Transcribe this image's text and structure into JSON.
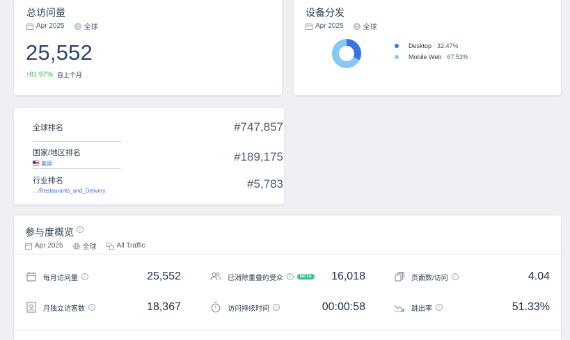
{
  "visits": {
    "title": "总访问量",
    "date": "Apr 2025",
    "region": "全球",
    "value": "25,552",
    "change": "81.97%",
    "change_label": "自上个月"
  },
  "devices": {
    "title": "设备分发",
    "date": "Apr 2025",
    "region": "全球",
    "items": [
      {
        "label": "Desktop",
        "pct": "32.47%",
        "value": 32.47,
        "color": "#3a74e0"
      },
      {
        "label": "Mobile Web",
        "pct": "67.53%",
        "value": 67.53,
        "color": "#86c7f5"
      }
    ]
  },
  "ranks": {
    "global_label": "全球排名",
    "global_value": "#747,857",
    "country_label": "国家/地区排名",
    "country_name": "美国",
    "country_value": "#189,175",
    "industry_label": "行业排名",
    "industry_name": "…/Restaurants_and_Delivery",
    "industry_value": "#5,783"
  },
  "engagement": {
    "title": "参与度概览",
    "date": "Apr 2025",
    "region": "全球",
    "traffic": "All Traffic",
    "monthly_visits_label": "每月访问量",
    "monthly_visits_value": "25,552",
    "dedup_label": "已消除重叠的受众",
    "dedup_badge": "BETA",
    "dedup_value": "16,018",
    "pages_label": "页面数/访问",
    "pages_value": "4.04",
    "unique_label": "月独立访客数",
    "unique_value": "18,367",
    "duration_label": "访问持续时间",
    "duration_value": "00:00:58",
    "bounce_label": "跳出率",
    "bounce_value": "51.33%"
  },
  "colors": {
    "accent": "#2b4470",
    "growth": "#2fb344",
    "link": "#3a74c5"
  }
}
